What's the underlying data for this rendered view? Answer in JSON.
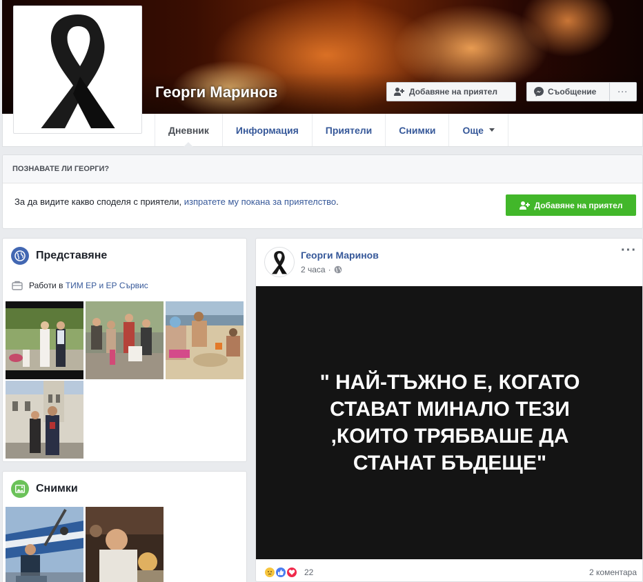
{
  "profile": {
    "name": "Георги Маринов",
    "add_friend_label": "Добавяне на приятел",
    "message_label": "Съобщение",
    "more_label": "···"
  },
  "nav": {
    "tabs": [
      {
        "label": "Дневник",
        "active": true
      },
      {
        "label": "Информация"
      },
      {
        "label": "Приятели"
      },
      {
        "label": "Снимки"
      },
      {
        "label": "Още"
      }
    ]
  },
  "know_card": {
    "heading": "ПОЗНАВАТЕ ЛИ ГЕОРГИ?",
    "text_before": "За да видите какво споделя с приятели, ",
    "link_text": "изпратете му покана за приятелство",
    "text_after": ".",
    "button_label": "Добавяне на приятел"
  },
  "intro": {
    "title": "Представяне",
    "work_prefix": "Работи в ",
    "work_link": "ТИМ ЕР и ЕР Сървис"
  },
  "photos_card": {
    "title": "Снимки"
  },
  "post": {
    "author": "Георги Маринов",
    "time": "2 часа",
    "quote": "\" НАЙ-ТЪЖНО Е, КОГАТО СТАВАТ МИНАЛО ТЕЗИ ,КОИТО ТРЯБВАШЕ ДА СТАНАТ БЪДЕЩЕ\"",
    "reactions_count": "22",
    "comments": "2 коментара"
  },
  "colors": {
    "link": "#365899",
    "green": "#42b72a",
    "intro_icon": "#4267b2",
    "photos_icon": "#6bc259"
  }
}
